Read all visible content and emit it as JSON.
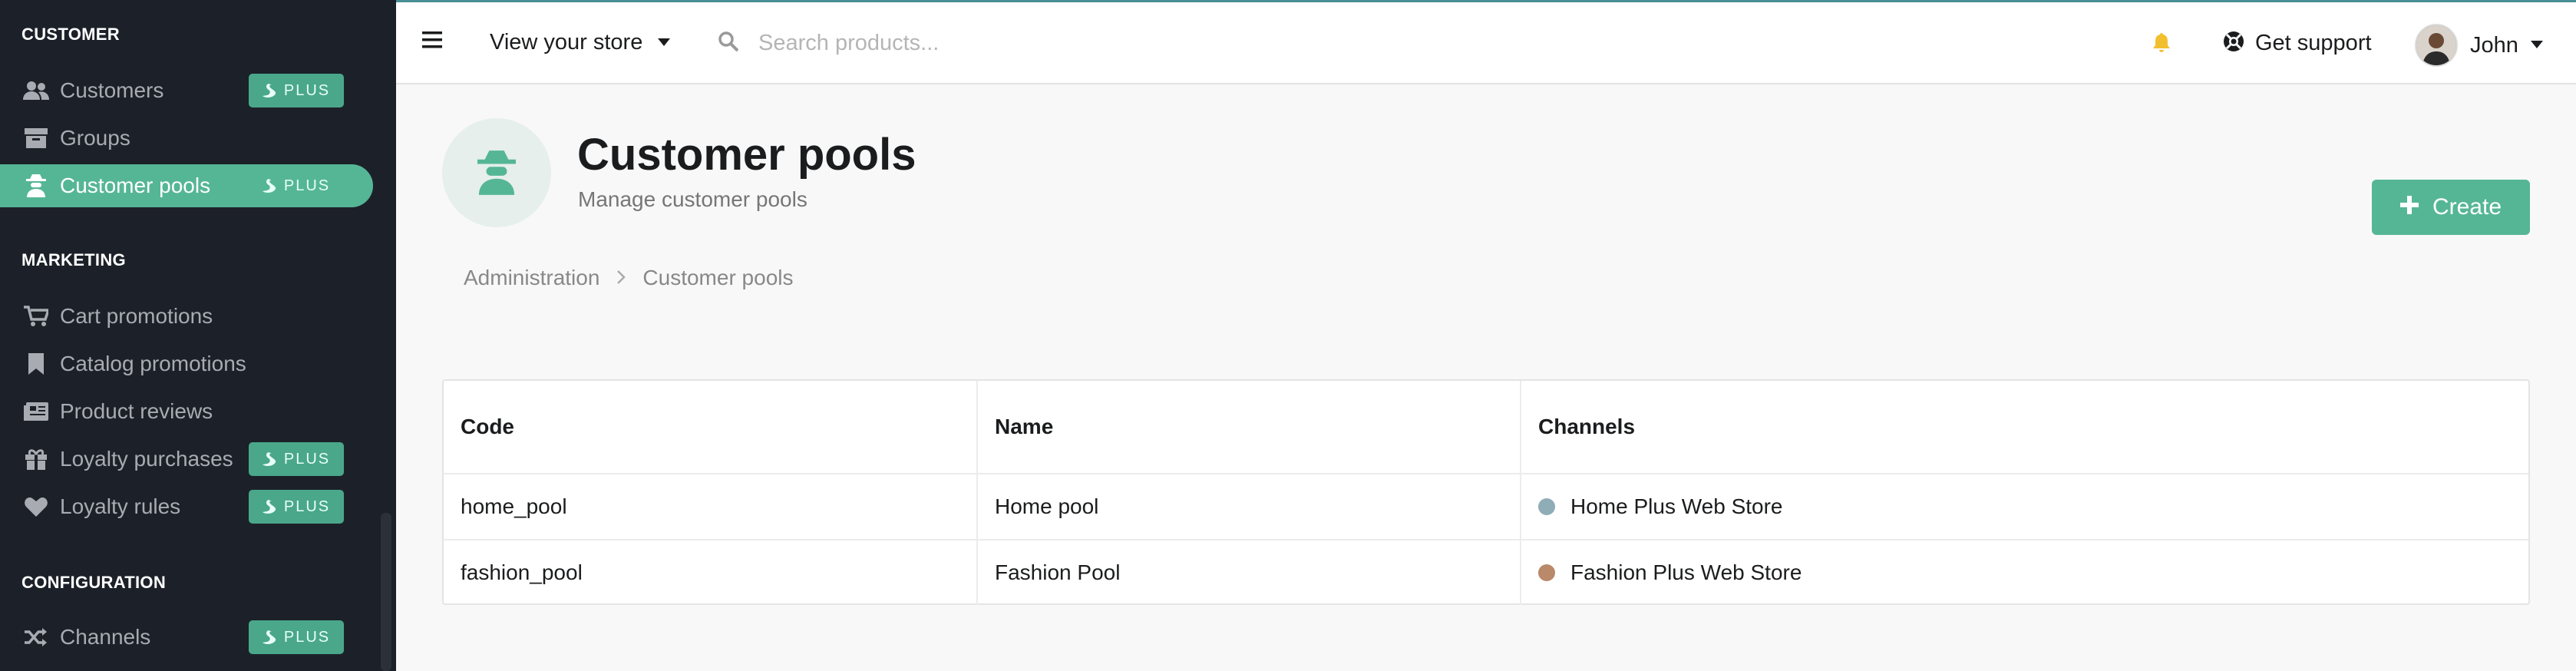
{
  "sidebar": {
    "sections": [
      {
        "label": "CUSTOMER"
      },
      {
        "label": "MARKETING"
      },
      {
        "label": "CONFIGURATION"
      }
    ],
    "items": [
      {
        "label": "Customers",
        "icon": "users-icon",
        "plus": true,
        "active": false
      },
      {
        "label": "Groups",
        "icon": "archive-icon",
        "plus": false,
        "active": false
      },
      {
        "label": "Customer pools",
        "icon": "user-secret-icon",
        "plus": true,
        "active": true
      },
      {
        "label": "Cart promotions",
        "icon": "cart-icon",
        "plus": false,
        "active": false
      },
      {
        "label": "Catalog promotions",
        "icon": "bookmark-icon",
        "plus": false,
        "active": false
      },
      {
        "label": "Product reviews",
        "icon": "newspaper-icon",
        "plus": false,
        "active": false
      },
      {
        "label": "Loyalty purchases",
        "icon": "gift-icon",
        "plus": true,
        "active": false
      },
      {
        "label": "Loyalty rules",
        "icon": "heart-icon",
        "plus": true,
        "active": false
      },
      {
        "label": "Channels",
        "icon": "shuffle-icon",
        "plus": true,
        "active": false
      }
    ],
    "plus_label": "PLUS"
  },
  "topbar": {
    "store_label": "View your store",
    "search_placeholder": "Search products...",
    "support_label": "Get support",
    "user_name": "John"
  },
  "header": {
    "title": "Customer pools",
    "subtitle": "Manage customer pools",
    "create_label": "Create"
  },
  "breadcrumb": [
    "Administration",
    "Customer pools"
  ],
  "table": {
    "columns": [
      "Code",
      "Name",
      "Channels"
    ],
    "rows": [
      {
        "code": "home_pool",
        "name": "Home pool",
        "channel": "Home Plus Web Store",
        "channel_color": "#8eadb6"
      },
      {
        "code": "fashion_pool",
        "name": "Fashion Pool",
        "channel": "Fashion Plus Web Store",
        "channel_color": "#b9896a"
      }
    ]
  },
  "colors": {
    "accent": "#55b696",
    "sidebar_bg": "#1c2129",
    "bell": "#f2bf2e"
  }
}
